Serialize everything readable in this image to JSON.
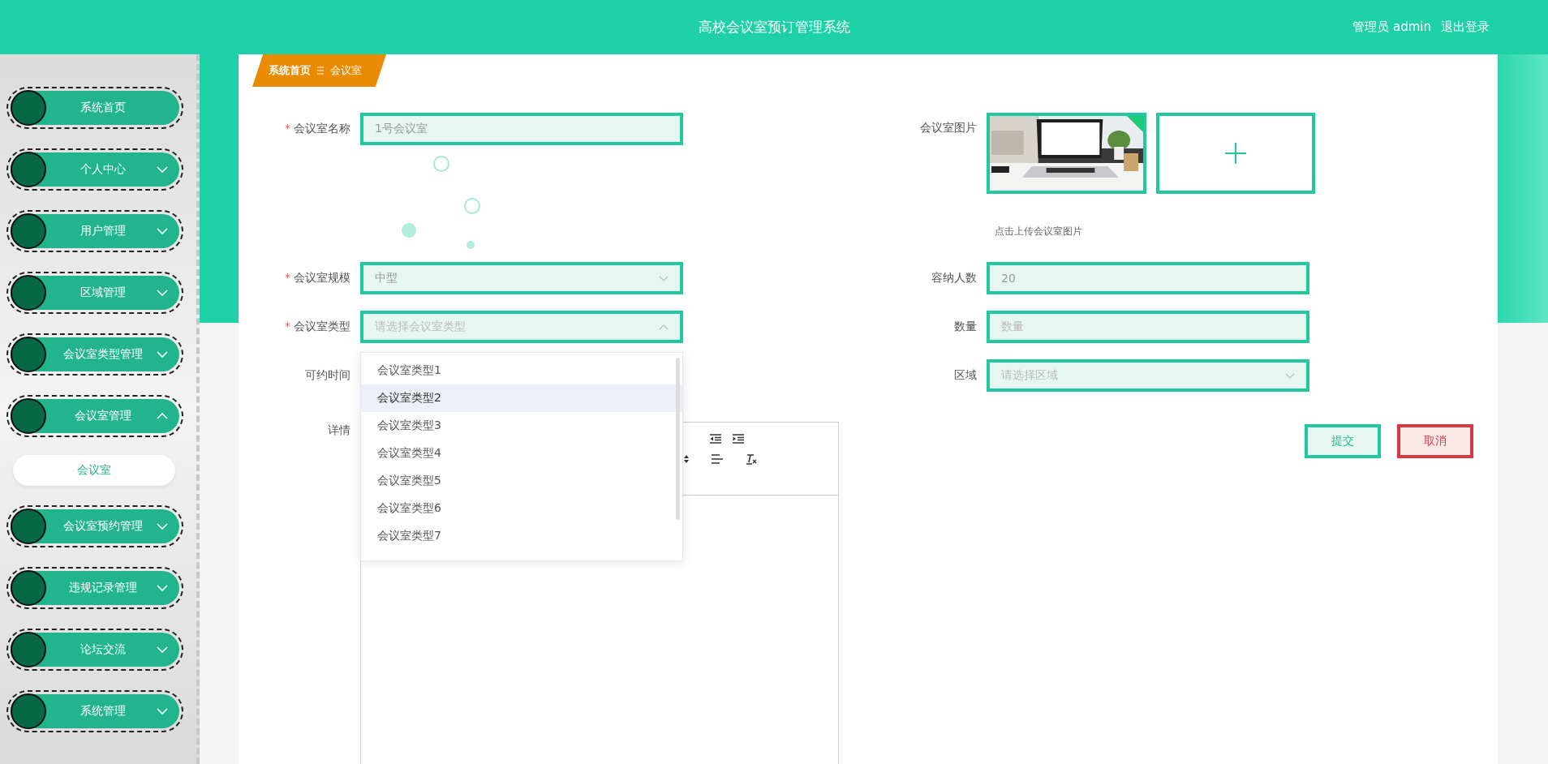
{
  "header": {
    "title": "高校会议室预订管理系统",
    "user": "管理员 admin",
    "logout": "退出登录"
  },
  "sidebar": {
    "items": [
      {
        "label": "系统首页",
        "kind": "link"
      },
      {
        "label": "个人中心",
        "kind": "group",
        "expanded": false
      },
      {
        "label": "用户管理",
        "kind": "group",
        "expanded": false
      },
      {
        "label": "区域管理",
        "kind": "group",
        "expanded": false
      },
      {
        "label": "会议室类型管理",
        "kind": "group",
        "expanded": false
      },
      {
        "label": "会议室管理",
        "kind": "group",
        "expanded": true,
        "children": [
          {
            "label": "会议室",
            "selected": true
          }
        ]
      },
      {
        "label": "会议室预约管理",
        "kind": "group",
        "expanded": false
      },
      {
        "label": "违规记录管理",
        "kind": "group",
        "expanded": false
      },
      {
        "label": "论坛交流",
        "kind": "group",
        "expanded": false
      },
      {
        "label": "系统管理",
        "kind": "group",
        "expanded": false
      }
    ]
  },
  "breadcrumb": [
    {
      "label": "系统首页"
    },
    {
      "label": "会议室"
    }
  ],
  "form": {
    "name": {
      "label": "会议室名称",
      "required_mark": "*",
      "value": "1号会议室"
    },
    "scale": {
      "label": "会议室规模",
      "required_mark": "*",
      "value": "中型"
    },
    "type": {
      "label": "会议室类型",
      "required_mark": "*",
      "placeholder": "请选择会议室类型",
      "open": true,
      "options": [
        {
          "label": "会议室类型1",
          "highlighted": false
        },
        {
          "label": "会议室类型2",
          "highlighted": true
        },
        {
          "label": "会议室类型3",
          "highlighted": false
        },
        {
          "label": "会议室类型4",
          "highlighted": false
        },
        {
          "label": "会议室类型5",
          "highlighted": false
        },
        {
          "label": "会议室类型6",
          "highlighted": false
        },
        {
          "label": "会议室类型7",
          "highlighted": false
        }
      ]
    },
    "time": {
      "label": "可约时间"
    },
    "detail": {
      "label": "详情"
    },
    "image": {
      "label": "会议室图片",
      "hint": "点击上传会议室图片",
      "images": [
        {
          "kind": "picture",
          "uploaded": true
        }
      ]
    },
    "capacity": {
      "label": "容纳人数",
      "value": "20"
    },
    "quantity": {
      "label": "数量",
      "placeholder": "数量"
    },
    "region": {
      "label": "区域",
      "placeholder": "请选择区域"
    }
  },
  "buttons": [
    {
      "label": "提交",
      "kind": "submit"
    },
    {
      "label": "取消",
      "kind": "cancel"
    }
  ]
}
